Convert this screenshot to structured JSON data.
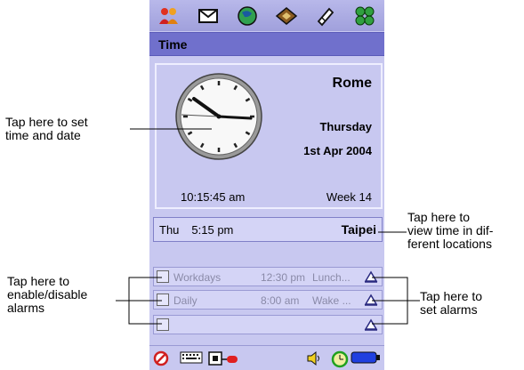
{
  "app": {
    "title": "Time"
  },
  "toolbar": {
    "icons": [
      "contacts-icon",
      "messaging-icon",
      "web-icon",
      "notes-icon",
      "sketch-icon",
      "launcher-icon"
    ]
  },
  "clock": {
    "city": "Rome",
    "weekday": "Thursday",
    "date": "1st Apr 2004",
    "digital_time": "10:15:45 am",
    "week": "Week 14"
  },
  "world": {
    "day": "Thu",
    "time": "5:15 pm",
    "city": "Taipei"
  },
  "alarms": [
    {
      "name": "Workdays",
      "time": "12:30 pm",
      "label": "Lunch..."
    },
    {
      "name": "Daily",
      "time": "8:00 am",
      "label": "Wake ..."
    },
    {
      "name": "",
      "time": "",
      "label": ""
    }
  ],
  "annotations": {
    "set_time": [
      "Tap here to set",
      "time and date"
    ],
    "world": [
      "Tap here to",
      "view time in dif-",
      "ferent locations"
    ],
    "enable": [
      "Tap here to",
      "enable/disable",
      "alarms"
    ],
    "set_alarms": [
      "Tap here to",
      "set alarms"
    ]
  },
  "colors": {
    "panel": "#c8c8f0",
    "title_bar": "#7070cc",
    "topbar": "#a8a8e2"
  }
}
